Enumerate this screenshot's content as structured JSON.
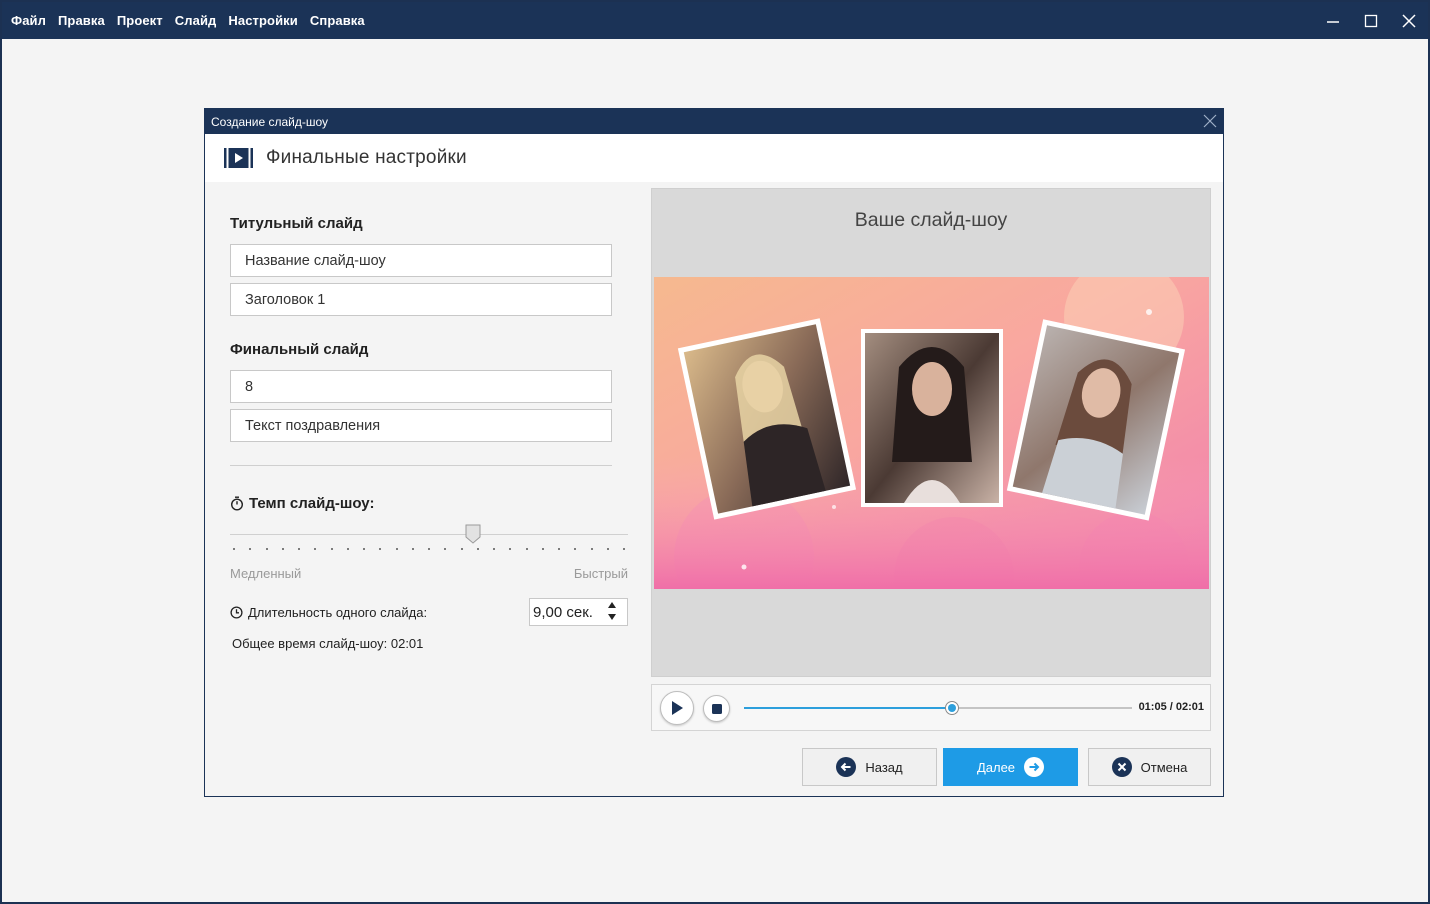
{
  "menubar": {
    "items": [
      "Файл",
      "Правка",
      "Проект",
      "Слайд",
      "Настройки",
      "Справка"
    ]
  },
  "dialog": {
    "title": "Создание слайд-шоу",
    "header_title": "Финальные настройки"
  },
  "title_slide": {
    "section_label": "Титульный слайд",
    "field1_value": "Название слайд-шоу",
    "field2_value": "Заголовок 1"
  },
  "final_slide": {
    "section_label": "Финальный слайд",
    "field1_value": "8",
    "field2_value": "Текст поздравления"
  },
  "tempo": {
    "label": "Темп слайд-шоу:",
    "slider_value_fraction": 0.61,
    "min_label": "Медленный",
    "max_label": "Быстрый"
  },
  "duration": {
    "label": "Длительность одного слайда:",
    "value": "9,00 сек.",
    "total_label": "Общее время слайд-шоу: 02:01"
  },
  "preview": {
    "title": "Ваше слайд-шоу"
  },
  "player": {
    "progress_fraction": 0.535,
    "time_text": "01:05 / 02:01"
  },
  "buttons": {
    "back_label": "Назад",
    "next_label": "Далее",
    "cancel_label": "Отмена"
  },
  "colors": {
    "titlebar": "#1b3357",
    "accent": "#1e9be6",
    "progress": "#2d9fdc"
  }
}
